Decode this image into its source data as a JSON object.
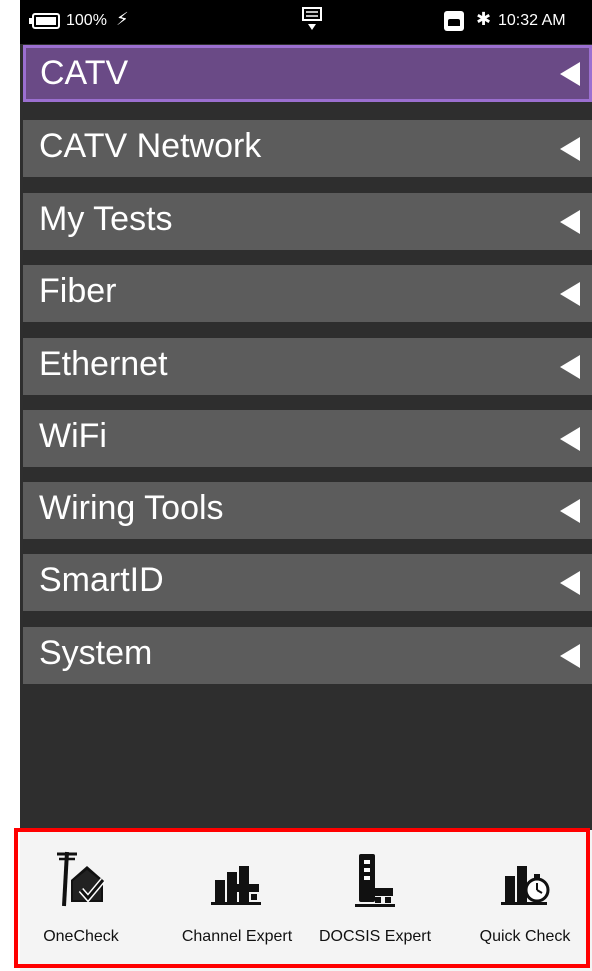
{
  "status_bar": {
    "battery": "100%",
    "charging_icon": "lightning-icon",
    "keyboard_icon": "keyboard-icon",
    "device_icon": "device-icon",
    "bluetooth_icon": "bluetooth-icon",
    "time": "10:32 AM"
  },
  "menu": {
    "items": [
      {
        "label": "CATV",
        "active": true
      },
      {
        "label": "CATV Network"
      },
      {
        "label": "My Tests"
      },
      {
        "label": "Fiber"
      },
      {
        "label": "Ethernet"
      },
      {
        "label": "WiFi"
      },
      {
        "label": "Wiring Tools"
      },
      {
        "label": "SmartID"
      },
      {
        "label": "System"
      }
    ]
  },
  "shortcuts": [
    {
      "label": "OneCheck",
      "icon": "house-check-icon"
    },
    {
      "label": "Channel Expert",
      "icon": "channel-expert-icon"
    },
    {
      "label": "DOCSIS Expert",
      "icon": "docsis-expert-icon"
    },
    {
      "label": "Quick Check",
      "icon": "quick-check-icon"
    }
  ],
  "colors": {
    "active_item": "#6a4a86",
    "active_border": "#9b6fd0",
    "item_bg": "#5c5c5c",
    "highlight": "#ff0000"
  }
}
